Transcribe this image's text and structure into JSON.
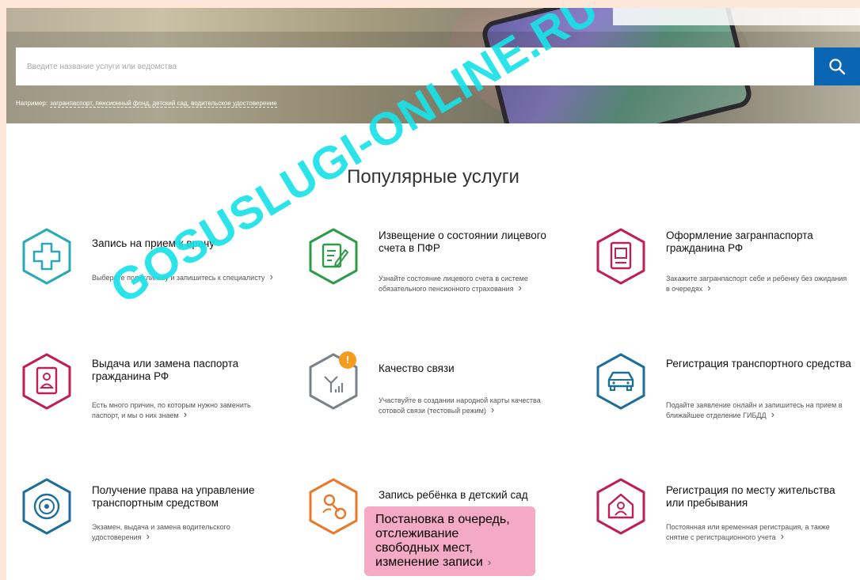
{
  "search": {
    "placeholder": "Введите название услуги или ведомства",
    "hint_prefix": "Например:",
    "hint_examples": "загранпаспорт, пенсионный фонд, детский сад, водительское удостоверение"
  },
  "section_title": "Популярные услуги",
  "watermark": "GOSUSLUGI-ONLINE.RU",
  "badge": "!",
  "colors": {
    "teal": "#2aa9b6",
    "green": "#2e9b48",
    "crimson": "#c01f56",
    "gray": "#7b8189",
    "blue": "#1e6e9b",
    "orange": "#e8792a",
    "pink": "#f4a9c4",
    "search_blue": "#0a66b5"
  },
  "services": [
    {
      "title": "Запись на прием к врачу",
      "desc": "Выберите поликлинику и запишитесь к специалисту",
      "icon": "medical-cross-icon"
    },
    {
      "title": "Извещение о состоянии лицевого счета в ПФР",
      "desc": "Узнайте состояние лицевого счета в системе обязательного пенсионного страхования",
      "icon": "document-edit-icon"
    },
    {
      "title": "Оформление загранпаспорта гражданина РФ",
      "desc": "Закажите загранпаспорт себе и ребенку без ожидания в очередях",
      "icon": "passport-icon"
    },
    {
      "title": "Выдача или замена паспорта гражданина РФ",
      "desc": "Есть много причин, по которым нужно заменить паспорт, и мы о них знаем",
      "icon": "passport-person-icon"
    },
    {
      "title": "Качество связи",
      "desc": "Участвуйте в создании народной карты качества сотовой связи (тестовый режим)",
      "icon": "signal-icon"
    },
    {
      "title": "Регистрация транспортного средства",
      "desc": "Подайте заявление онлайн и запишитесь на прием в ближайшее отделение ГИБДД",
      "icon": "car-icon"
    },
    {
      "title": "Получение права на управление транспортным средством",
      "desc": "Экзамен, выдача и замена водительского удостоверения",
      "icon": "steering-wheel-icon"
    },
    {
      "title": "Запись ребёнка в детский сад",
      "desc": "Постановка в очередь, отслеживание свободных мест, изменение записи",
      "icon": "pacifier-icon"
    },
    {
      "title": "Регистрация по месту жительства или пребывания",
      "desc": "Постоянная или временная регистрация, а также снятие с регистрационного учета",
      "icon": "house-person-icon"
    }
  ]
}
